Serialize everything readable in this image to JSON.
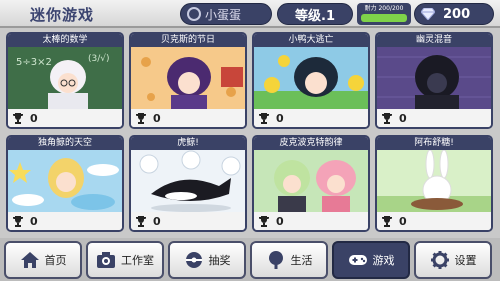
{
  "header": {
    "title": "迷你游戏",
    "player_name": "小蛋蛋",
    "level": "等级.1",
    "stamina_label": "耐力 200/200",
    "stamina_fraction": 1.0,
    "gems": "200"
  },
  "games": [
    {
      "title": "太棒的数学",
      "score": "0"
    },
    {
      "title": "贝克斯的节日",
      "score": "0"
    },
    {
      "title": "小鸭大逃亡",
      "score": "0"
    },
    {
      "title": "幽灵混音",
      "score": "0"
    },
    {
      "title": "独角鲸的天空",
      "score": "0"
    },
    {
      "title": "虎鲸!",
      "score": "0"
    },
    {
      "title": "皮克波克特韵律",
      "score": "0"
    },
    {
      "title": "阿布舒糖!",
      "score": "0"
    }
  ],
  "nav": [
    {
      "label": "首页",
      "icon": "home-icon"
    },
    {
      "label": "工作室",
      "icon": "camera-icon"
    },
    {
      "label": "抽奖",
      "icon": "capsule-icon"
    },
    {
      "label": "生活",
      "icon": "tree-icon"
    },
    {
      "label": "游戏",
      "icon": "gamepad-icon"
    },
    {
      "label": "设置",
      "icon": "gear-icon"
    }
  ],
  "colors": {
    "accent": "#3a4266",
    "stamina": "#7fd24a"
  }
}
